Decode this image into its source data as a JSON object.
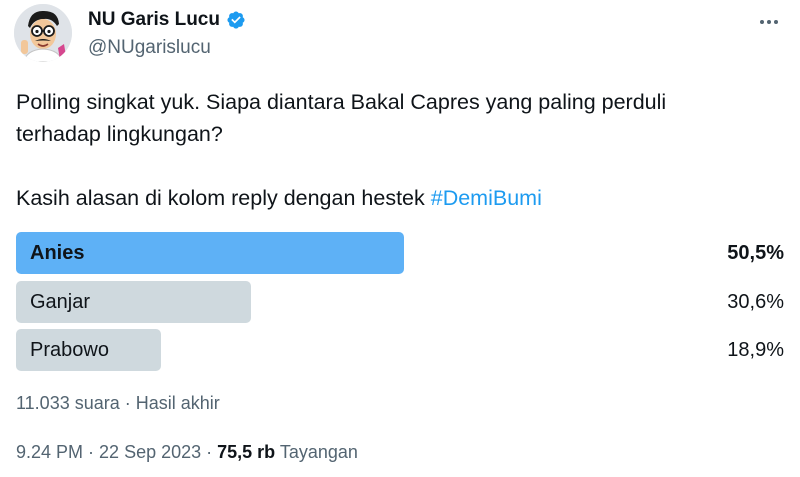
{
  "account": {
    "display_name": "NU Garis Lucu",
    "handle": "@NUgarislucu",
    "verified": true,
    "verified_color": "#1d9bf0"
  },
  "tweet": {
    "line1": "Polling singkat yuk. Siapa diantara Bakal Capres yang paling perduli",
    "line2": "terhadap lingkungan?",
    "line3_text": "Kasih alasan di kolom reply dengan hestek ",
    "hashtag": "#DemiBumi"
  },
  "poll": {
    "options": [
      {
        "label": "Anies",
        "percent_text": "50,5%",
        "percent": 50.5,
        "winner": true
      },
      {
        "label": "Ganjar",
        "percent_text": "30,6%",
        "percent": 30.6,
        "winner": false
      },
      {
        "label": "Prabowo",
        "percent_text": "18,9%",
        "percent": 18.9,
        "winner": false
      }
    ],
    "votes": "11.033 suara",
    "separator": " · ",
    "status": "Hasil akhir",
    "winner_color": "#5eb1f6",
    "other_color": "#cfd9de"
  },
  "meta": {
    "time": "9.24 PM",
    "date": "22 Sep 2023",
    "separator": " · ",
    "views_count": "75,5 rb",
    "views_label": "Tayangan"
  }
}
